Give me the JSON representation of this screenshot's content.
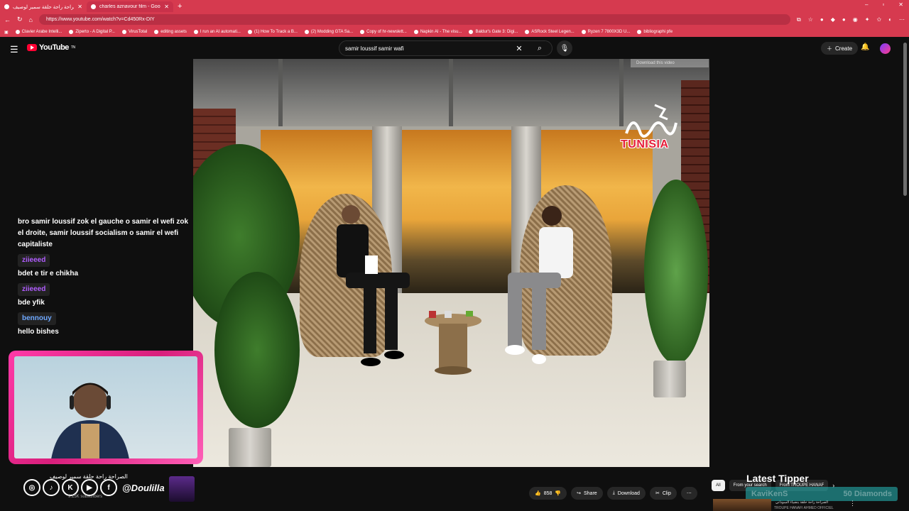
{
  "browser": {
    "tabs": [
      {
        "label": "الصراحة راحة حلقة سمير لوصيف",
        "active": false
      },
      {
        "label": "charles aznavour film - Google Se",
        "active": true
      }
    ],
    "new_tab": "+",
    "url": "https://www.youtube.com/watch?v=Cd450Rx-DIY",
    "bookmarks": [
      "Clavier Arabe Intelli...",
      "Ziperto - A Digital P...",
      "VirusTotal",
      "editing assets",
      "I run an AI automati...",
      "(1) How To Track a B...",
      "(2) Modding GTA Sa...",
      "Copy of hr-newslett...",
      "Napkin AI - The visu...",
      "Baldur's Gate 3: Digi...",
      "ASRock Steel Legen...",
      "Ryzen 7 7800X3D U...",
      "bibliographi pfe"
    ]
  },
  "youtube": {
    "logo_text": "YouTube",
    "logo_sup": "TN",
    "search_query": "samir loussif samir wafi",
    "create_label": "Create"
  },
  "video": {
    "download_hint": "Download this video",
    "watermark_text": "TUNISIA"
  },
  "chat": {
    "messages": [
      {
        "user": "",
        "text": "bro samir loussif zok el gauche o samir el wefi zok el droite, samir loussif socialism o samir el wefi capitaliste"
      },
      {
        "user": "ziieeed",
        "user_color": "#b05cff",
        "text": "bdet e tir e chikha"
      },
      {
        "user": "ziieeed",
        "user_color": "#b05cff",
        "text": "bde yfik"
      },
      {
        "user": "bennouy",
        "user_color": "#6ea8ff",
        "text": "hello bishes"
      }
    ]
  },
  "overlay": {
    "handle": "@Doulilla",
    "video_title": "الصراحة راحة حلقة سمير لوصيف",
    "subscribers": "9.15K subscribers"
  },
  "actions": {
    "likes": "858",
    "share": "Share",
    "download": "Download",
    "clip": "Clip",
    "more": "⋯"
  },
  "filters": [
    "All",
    "From your search",
    "From TROUPE HANAF"
  ],
  "tipper": {
    "title": "Latest Tipper",
    "name": "KaviKenS",
    "amount": "50 Diamonds"
  },
  "recommendation": {
    "title": "الصراحة راحة حلقة بنضياء السوداني",
    "channel": "TROUPE HANAFI AHMED OFFICIEL"
  },
  "colors": {
    "browser_accent": "#d63a4f",
    "yt_red": "#ff0033",
    "cam_border": "#ff3aa8"
  }
}
